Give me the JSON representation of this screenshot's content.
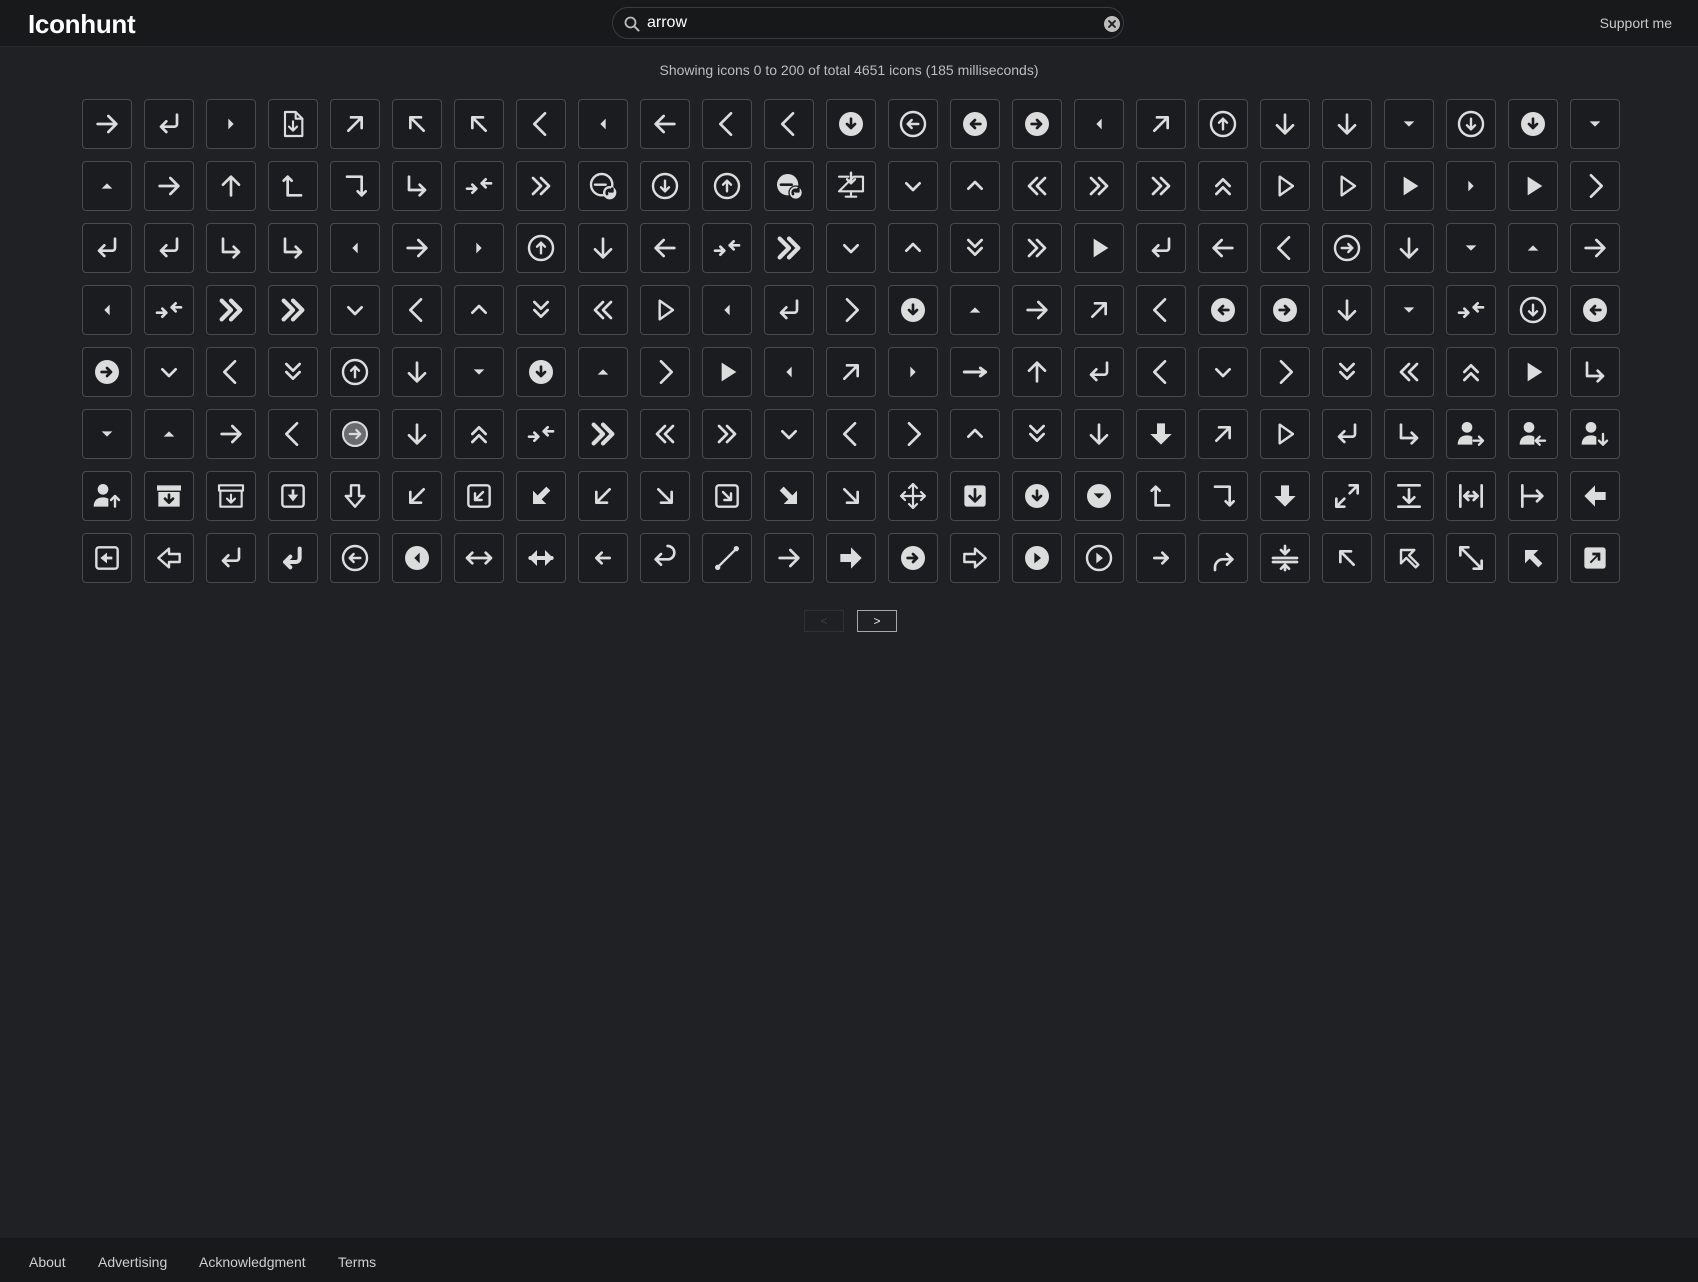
{
  "header": {
    "logo": "Iconhunt",
    "search_value": "arrow",
    "support": "Support me"
  },
  "results_info": "Showing icons 0 to 200 of total 4651 icons (185 milliseconds)",
  "icons": [
    "arrow-right",
    "return-left",
    "caret-right",
    "file-download",
    "arrow-up-right",
    "arrow-up-left",
    "arrow-up-left",
    "chevron-left",
    "caret-left",
    "arrow-left",
    "chevron-left",
    "chevron-left",
    "circle-down-solid",
    "circle-left",
    "circle-left-solid",
    "circle-right-solid",
    "caret-left",
    "arrow-up-right",
    "circle-up",
    "arrow-down",
    "arrow-down",
    "caret-down",
    "circle-down",
    "circle-down-solid",
    "caret-down",
    "caret-up",
    "arrow-right",
    "arrow-up",
    "turn-left-up",
    "turn-right-down",
    "turn-down-right",
    "arrows-collapse",
    "chevrons-right",
    "circle-redo",
    "circle-down",
    "circle-up",
    "circle-redo-solid",
    "monitor-download",
    "chevron-down",
    "chevron-up",
    "chevrons-left",
    "chevrons-right",
    "chevrons-right",
    "chevrons-up",
    "play-outline",
    "play-outline",
    "play-solid",
    "caret-right",
    "play-solid",
    "chevron-right",
    "return-left",
    "return-left",
    "turn-down-right",
    "turn-down-right",
    "caret-left",
    "arrow-right",
    "caret-right",
    "circle-up",
    "arrow-down",
    "arrow-left",
    "arrows-collapse",
    "chevrons-right-bold",
    "chevron-down",
    "chevron-up",
    "chevrons-down",
    "chevrons-right",
    "play-solid",
    "return-left",
    "arrow-left",
    "chevron-left",
    "circle-right",
    "arrow-down",
    "caret-down",
    "caret-up",
    "arrow-right",
    "caret-left",
    "arrows-collapse",
    "chevrons-right-bold",
    "chevrons-right-bold",
    "chevron-down",
    "chevron-left",
    "chevron-up",
    "chevrons-down",
    "chevrons-left",
    "play-outline",
    "caret-left",
    "return-left",
    "chevron-right",
    "circle-down-solid",
    "caret-up",
    "arrow-right",
    "arrow-up-right",
    "chevron-left",
    "circle-left-solid",
    "circle-right-solid",
    "arrow-down",
    "caret-down",
    "arrows-collapse",
    "circle-down",
    "circle-left-solid",
    "circle-right-solid",
    "chevron-down",
    "chevron-left",
    "chevrons-down",
    "circle-up",
    "arrow-down",
    "caret-down",
    "circle-down-solid",
    "caret-up",
    "chevron-right",
    "play-solid",
    "caret-left",
    "arrow-up-right",
    "caret-right",
    "arrow-right-bar",
    "arrow-up",
    "return-left",
    "chevron-left",
    "chevron-down",
    "chevron-right",
    "chevrons-down",
    "chevrons-left",
    "chevrons-up",
    "play-solid",
    "turn-down-right",
    "caret-down",
    "caret-up",
    "arrow-right",
    "chevron-left",
    "circle-right-gray",
    "arrow-down",
    "chevrons-up",
    "arrows-collapse",
    "chevrons-right-bold",
    "chevrons-left",
    "chevrons-right",
    "chevron-down",
    "chevron-left",
    "chevron-right",
    "chevron-up",
    "chevrons-down",
    "arrow-down",
    "arrow-down-bold",
    "arrow-up-right",
    "play-outline",
    "return-left",
    "turn-down-right",
    "user-arrow-right",
    "user-arrow-left",
    "user-arrow-down",
    "user-arrow-up",
    "archive-down-solid",
    "archive-down",
    "square-download",
    "arrow-down-outline",
    "arrow-down-left",
    "square-arrow-down-left",
    "arrow-down-left-bold",
    "arrow-down-left",
    "arrow-down-right",
    "square-arrow-down-right",
    "arrow-down-right-bold",
    "arrow-down-right",
    "move",
    "square-down-solid",
    "circle-down-solid",
    "circle-caret-down-solid",
    "turn-left-up",
    "turn-right-down",
    "arrow-down-bold",
    "expand",
    "align-bottom",
    "width",
    "arrow-right-bar-left",
    "arrow-left-bold",
    "square-left",
    "arrow-left-outline",
    "return-left",
    "return-left-bold",
    "circle-left",
    "circle-caret-left-solid",
    "arrows-h",
    "arrows-h-bold",
    "arrow-left-small",
    "undo",
    "resize-diagonal",
    "arrow-right",
    "arrow-right-bold",
    "circle-right-solid",
    "arrow-right-outline",
    "circle-play-solid",
    "circle-play",
    "arrow-right-small",
    "redo",
    "collapse-vertical",
    "arrow-up-left",
    "arrow-up-left-outline",
    "expand-diagonal",
    "arrow-up-left-bold",
    "square-arrow-up-right-solid"
  ],
  "pagination": {
    "prev": "<",
    "next": ">"
  },
  "footer": {
    "links": [
      "About",
      "Advertising",
      "Acknowledgment",
      "Terms"
    ]
  },
  "colors": {
    "background": "#202125",
    "header": "#18191b",
    "tile_border": "#4a4b50",
    "icon": "#dcdcdc"
  }
}
